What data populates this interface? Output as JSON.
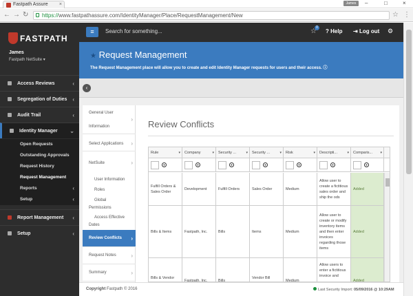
{
  "browser": {
    "tab_title": "Fastpath Assure",
    "user": "James",
    "url_secure": "https://",
    "url_rest": "www.fastpathassure.com/IdentityManager/Place/RequestManagement/New"
  },
  "sidebar": {
    "logo": "FASTPATH",
    "user_name": "James",
    "company": "Fastpath NetSuite ▾",
    "items": [
      {
        "label": "Access Reviews"
      },
      {
        "label": "Segregation of Duties"
      },
      {
        "label": "Audit Trail"
      },
      {
        "label": "Identity Manager"
      },
      {
        "label": "Report Management"
      },
      {
        "label": "Setup"
      }
    ],
    "sub_items": [
      {
        "label": "Open Requests"
      },
      {
        "label": "Outstanding Approvals"
      },
      {
        "label": "Request History"
      },
      {
        "label": "Request Management"
      },
      {
        "label": "Reports"
      },
      {
        "label": "Setup"
      }
    ]
  },
  "topbar": {
    "search_placeholder": "Search for something...",
    "badge": "0",
    "help": "Help",
    "logout": "Log out"
  },
  "banner": {
    "title": "Request Management",
    "desc": "The Request Management place will allow you to create and edit Identity Manager requests for users and their access."
  },
  "wizard": [
    {
      "label": "General User"
    },
    {
      "label": "Information"
    },
    {
      "label": "Select Applications"
    },
    {
      "label": "NetSuite"
    },
    {
      "label": "User Information"
    },
    {
      "label": "Roles"
    },
    {
      "label": "Global"
    },
    {
      "label": "Permissions"
    },
    {
      "label": "Access Effective"
    },
    {
      "label": "Dates"
    },
    {
      "label": "Review Conflicts"
    },
    {
      "label": "Request Notes"
    },
    {
      "label": "Summary"
    }
  ],
  "review": {
    "title": "Review Conflicts",
    "columns": [
      "Rule",
      "Company",
      "Security ...",
      "Security ...",
      "Risk",
      "Descripti...",
      "Comparis..."
    ],
    "rows": [
      [
        "Fulfill Orders & Sales Order",
        "Development",
        "Fulfill Orders",
        "Sales Order",
        "Medium",
        "Allow user to create a fictitious sales order and ship the ods",
        "Added"
      ],
      [
        "Bills & Items",
        "Fastpath, Inc.",
        "Bills",
        "Items",
        "Medium",
        "Allow user to create or modify inventory items and then enter invoices regarding those items",
        "Added"
      ],
      [
        "Bills & Vendor Bill Approval",
        "Fastpath, Inc.",
        "Bills",
        "Vendor Bill Approval",
        "Medium",
        "Allow users to enter a fictitious invoice and",
        "Added"
      ]
    ]
  },
  "footer": {
    "copyright_label": "Copyright",
    "copyright_text": "Fastpath © 2016",
    "import_label": "Last Security Import:",
    "import_value": "05/09/2016 @ 10:29AM"
  }
}
